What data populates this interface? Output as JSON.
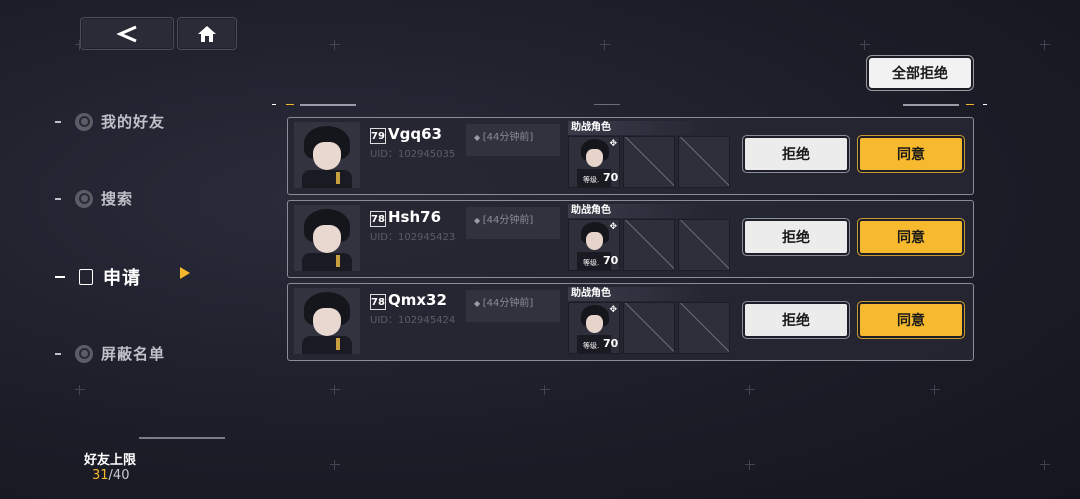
{
  "nav": {
    "back_icon": "back-arrow-icon",
    "home_icon": "home-icon"
  },
  "sidebar": {
    "items": [
      {
        "label": "我的好友",
        "icon": "friends-icon",
        "active": false
      },
      {
        "label": "搜索",
        "icon": "search-icon",
        "active": false
      },
      {
        "label": "申请",
        "icon": "list-icon",
        "active": true
      },
      {
        "label": "屏蔽名单",
        "icon": "block-icon",
        "active": false
      }
    ],
    "limit_title": "好友上限",
    "limit_current": "31",
    "limit_max": "/40"
  },
  "reject_all_label": "全部拒绝",
  "requests": [
    {
      "level": "79",
      "name": "Vgq63",
      "uid": "UID：102945035",
      "time": "[44分钟前]",
      "assist_label": "助战角色",
      "assist_level_label": "等级.",
      "assist_level": "70",
      "reject_label": "拒绝",
      "accept_label": "同意"
    },
    {
      "level": "78",
      "name": "Hsh76",
      "uid": "UID：102945423",
      "time": "[44分钟前]",
      "assist_label": "助战角色",
      "assist_level_label": "等级.",
      "assist_level": "70",
      "reject_label": "拒绝",
      "accept_label": "同意"
    },
    {
      "level": "78",
      "name": "Qmx32",
      "uid": "UID：102945424",
      "time": "[44分钟前]",
      "assist_label": "助战角色",
      "assist_level_label": "等级.",
      "assist_level": "70",
      "reject_label": "拒绝",
      "accept_label": "同意"
    }
  ],
  "colors": {
    "accent": "#f7b92d",
    "panel": "#262732",
    "background": "#1c1d28"
  }
}
